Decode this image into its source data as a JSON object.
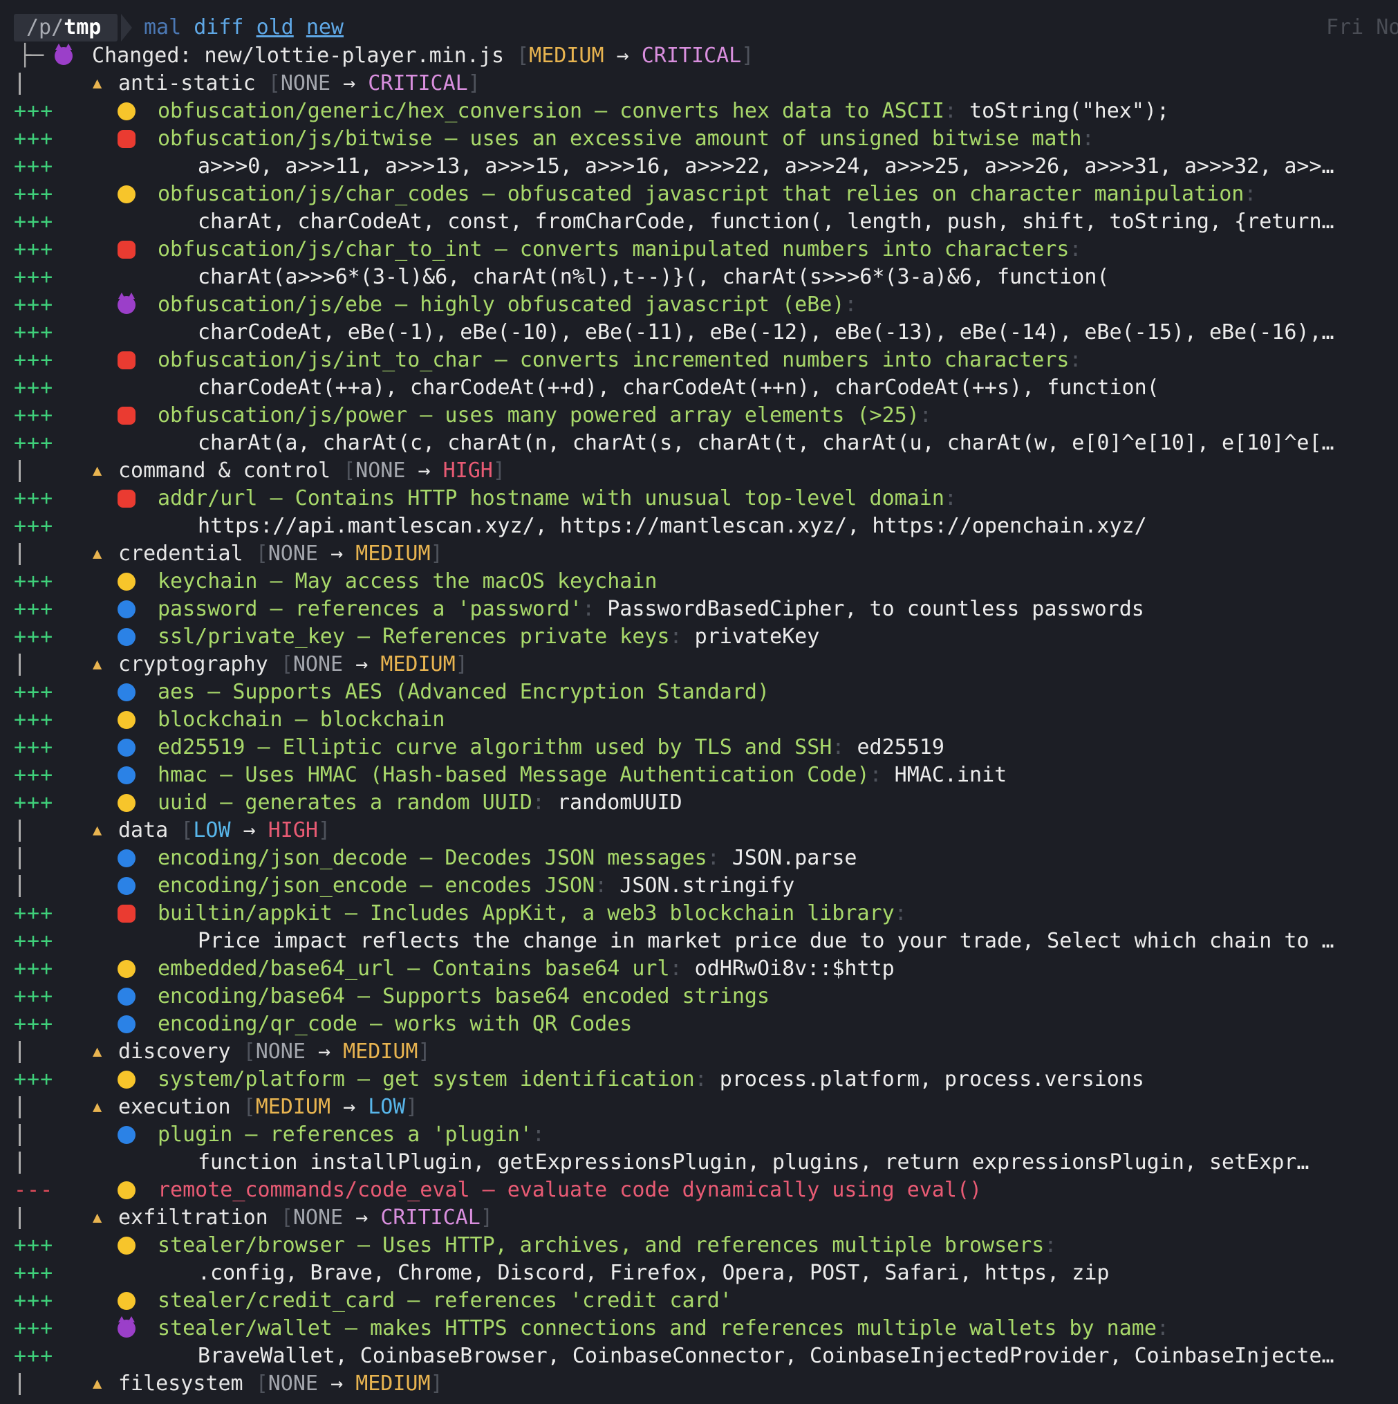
{
  "prompt": {
    "path_prefix": "/p/",
    "path_dir": "tmp",
    "command": "mal",
    "subcommand": "diff",
    "arg_old": "old",
    "arg_new": "new",
    "clock": "Fri No"
  },
  "header": {
    "tree_glyph": "├─",
    "label": "Changed: new/lottie-player.min.js",
    "from": "MEDIUM",
    "arrow": "→",
    "to": "CRITICAL"
  },
  "categories": {
    "anti_static": {
      "name": "anti-static",
      "from": "NONE",
      "to": "CRITICAL"
    },
    "c2": {
      "name": "command & control",
      "from": "NONE",
      "to": "HIGH"
    },
    "credential": {
      "name": "credential",
      "from": "NONE",
      "to": "MEDIUM"
    },
    "cryptography": {
      "name": "cryptography",
      "from": "NONE",
      "to": "MEDIUM"
    },
    "data": {
      "name": "data",
      "from": "LOW",
      "to": "HIGH"
    },
    "discovery": {
      "name": "discovery",
      "from": "NONE",
      "to": "MEDIUM"
    },
    "execution": {
      "name": "execution",
      "from": "MEDIUM",
      "to": "LOW"
    },
    "exfiltration": {
      "name": "exfiltration",
      "from": "NONE",
      "to": "CRITICAL"
    },
    "filesystem": {
      "name": "filesystem",
      "from": "NONE",
      "to": "MEDIUM"
    }
  },
  "gutter": {
    "added": "+++",
    "removed": "---"
  },
  "arrow": "→",
  "findings": {
    "hex_conversion": {
      "desc": "obfuscation/generic/hex_conversion — converts hex data to ASCII",
      "match": "toString(\"hex\");"
    },
    "bitwise": {
      "desc": "obfuscation/js/bitwise — uses an excessive amount of unsigned bitwise math",
      "match": "a>>>0, a>>>11, a>>>13, a>>>15, a>>>16, a>>>22, a>>>24, a>>>25, a>>>26, a>>>31, a>>>32, a>>…"
    },
    "char_codes": {
      "desc": "obfuscation/js/char_codes — obfuscated javascript that relies on character manipulation",
      "match": "charAt, charCodeAt, const, fromCharCode, function(, length, push, shift, toString, {return…"
    },
    "char_to_int": {
      "desc": "obfuscation/js/char_to_int — converts manipulated numbers into characters",
      "match": "charAt(a>>>6*(3-l)&6, charAt(n%l),t--)}(, charAt(s>>>6*(3-a)&6, function("
    },
    "ebe": {
      "desc": "obfuscation/js/ebe — highly obfuscated javascript (eBe)",
      "match": "charCodeAt, eBe(-1), eBe(-10), eBe(-11), eBe(-12), eBe(-13), eBe(-14), eBe(-15), eBe(-16),…"
    },
    "int_to_char": {
      "desc": "obfuscation/js/int_to_char — converts incremented numbers into characters",
      "match": "charCodeAt(++a), charCodeAt(++d), charCodeAt(++n), charCodeAt(++s), function("
    },
    "power": {
      "desc": "obfuscation/js/power — uses many powered array elements (>25)",
      "match": "charAt(a, charAt(c, charAt(n, charAt(s, charAt(t, charAt(u, charAt(w, e[0]^e[10], e[10]^e[…"
    },
    "addr_url": {
      "desc": "addr/url — Contains HTTP hostname with unusual top-level domain",
      "match": "https://api.mantlescan.xyz/, https://mantlescan.xyz/, https://openchain.xyz/"
    },
    "keychain": {
      "desc": "keychain — May access the macOS keychain"
    },
    "password": {
      "desc": "password — references a 'password'",
      "match": "PasswordBasedCipher, to countless passwords"
    },
    "private_key": {
      "desc": "ssl/private_key — References private keys",
      "match": "privateKey"
    },
    "aes": {
      "desc": "aes — Supports AES (Advanced Encryption Standard)"
    },
    "blockchain": {
      "desc": "blockchain — blockchain"
    },
    "ed25519": {
      "desc": "ed25519 — Elliptic curve algorithm used by TLS and SSH",
      "match": "ed25519"
    },
    "hmac": {
      "desc": "hmac — Uses HMAC (Hash-based Message Authentication Code)",
      "match": "HMAC.init"
    },
    "uuid": {
      "desc": "uuid — generates a random UUID",
      "match": "randomUUID"
    },
    "json_decode": {
      "desc": "encoding/json_decode — Decodes JSON messages",
      "match": "JSON.parse"
    },
    "json_encode": {
      "desc": "encoding/json_encode — encodes JSON",
      "match": "JSON.stringify"
    },
    "appkit": {
      "desc": "builtin/appkit — Includes AppKit, a web3 blockchain library",
      "match": "Price impact reflects the change in market price due to your trade, Select which chain to …"
    },
    "base64_url": {
      "desc": "embedded/base64_url — Contains base64 url",
      "match": "odHRwOi8v::$http"
    },
    "base64": {
      "desc": "encoding/base64 — Supports base64 encoded strings"
    },
    "qr_code": {
      "desc": "encoding/qr_code — works with QR Codes"
    },
    "platform": {
      "desc": "system/platform — get system identification",
      "match": "process.platform, process.versions"
    },
    "plugin": {
      "desc": "plugin — references a 'plugin'",
      "match": "function installPlugin, getExpressionsPlugin, plugins, return expressionsPlugin, setExpr…"
    },
    "code_eval": {
      "desc": "remote_commands/code_eval — evaluate code dynamically using eval()"
    },
    "stealer_browser": {
      "desc": "stealer/browser — Uses HTTP, archives, and references multiple browsers",
      "match": ".config, Brave, Chrome, Discord, Firefox, Opera, POST, Safari, https, zip"
    },
    "credit_card": {
      "desc": "stealer/credit_card — references 'credit card'"
    },
    "wallet": {
      "desc": "stealer/wallet — makes HTTPS connections and references multiple wallets by name",
      "match": "BraveWallet, CoinbaseBrowser, CoinbaseConnector, CoinbaseInjectedProvider, CoinbaseInjecte…"
    }
  },
  "colors": {
    "added": "#3fd07a",
    "removed": "#e04b5a",
    "description": "#a8d86a",
    "critical": "#d98fde",
    "high": "#e85b74",
    "medium": "#e8b450",
    "low": "#58b6ea"
  }
}
